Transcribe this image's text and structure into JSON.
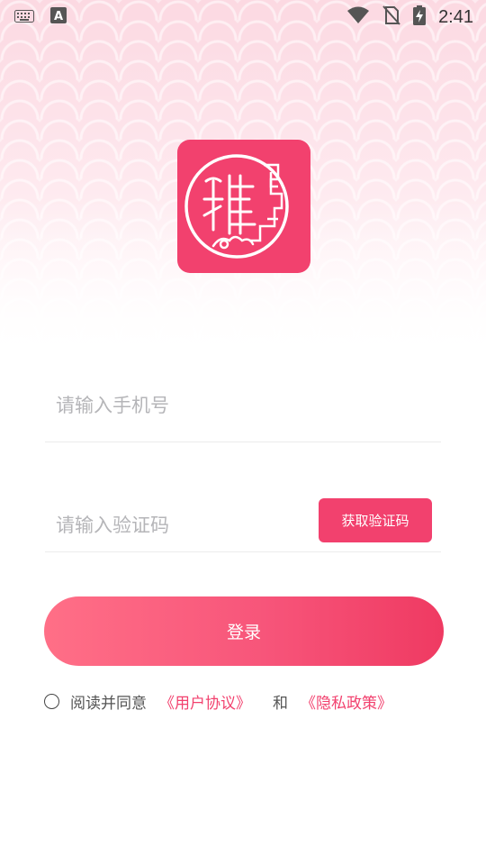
{
  "status_bar": {
    "time": "2:41",
    "left_icons": [
      "keyboard-icon",
      "a-badge-icon"
    ],
    "right_icons": [
      "wifi-icon",
      "no-sim-icon",
      "battery-charging-icon"
    ]
  },
  "logo": {
    "icon": "seal-logo-icon"
  },
  "form": {
    "phone_placeholder": "请输入手机号",
    "code_placeholder": "请输入验证码",
    "get_code_label": "获取验证码",
    "login_label": "登录"
  },
  "agreement": {
    "prefix": "阅读并同意",
    "user_agreement": "《用户协议》",
    "conjunction": "和",
    "privacy_policy": "《隐私政策》"
  },
  "colors": {
    "accent": "#f2416e",
    "gradient_start": "#ff6f87",
    "gradient_end": "#ef3a62",
    "placeholder": "#b5b5b8"
  }
}
